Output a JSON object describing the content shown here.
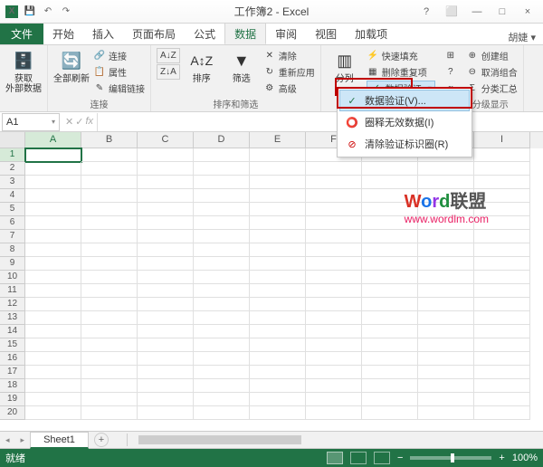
{
  "titlebar": {
    "title": "工作簿2 - Excel",
    "help": "?",
    "ribbon_opts": "⬜",
    "min": "—",
    "max": "□",
    "close": "×"
  },
  "tabs": {
    "file": "文件",
    "home": "开始",
    "insert": "插入",
    "layout": "页面布局",
    "formulas": "公式",
    "data": "数据",
    "review": "审阅",
    "view": "视图",
    "addins": "加载项",
    "user": "胡婕 ▾"
  },
  "ribbon": {
    "get_external": "获取\n外部数据",
    "refresh_all": "全部刷新",
    "connections": "连接",
    "properties": "属性",
    "edit_links": "编辑链接",
    "group_conn": "连接",
    "sort_az": "A↓Z",
    "sort_za": "Z↓A",
    "sort": "排序",
    "filter": "筛选",
    "clear": "清除",
    "reapply": "重新应用",
    "advanced": "高级",
    "group_sort": "排序和筛选",
    "text_to_cols": "分列",
    "flash_fill": "快速填充",
    "remove_dup": "删除重复项",
    "data_validation": "数据验证",
    "group_btn": "创建组",
    "ungroup": "取消组合",
    "subtotal": "分类汇总",
    "outline_show": "分级显示"
  },
  "dd": {
    "validation": "数据验证(V)...",
    "circle": "圈释无效数据(I)",
    "clear_circles": "清除验证标识圈(R)"
  },
  "namebox": "A1",
  "fx": "fx",
  "cols": [
    "A",
    "B",
    "C",
    "D",
    "E",
    "F",
    "G",
    "H",
    "I"
  ],
  "rows": [
    "1",
    "2",
    "3",
    "4",
    "5",
    "6",
    "7",
    "8",
    "9",
    "10",
    "11",
    "12",
    "13",
    "14",
    "15",
    "16",
    "17",
    "18",
    "19",
    "20"
  ],
  "watermark": {
    "w": "W",
    "o": "o",
    "r": "r",
    "d": "d",
    "rest": "联盟",
    "url": "www.wordlm.com"
  },
  "sheet": {
    "name": "Sheet1",
    "add": "+"
  },
  "status": {
    "ready": "就绪",
    "zoom": "100%",
    "minus": "−",
    "plus": "+"
  }
}
